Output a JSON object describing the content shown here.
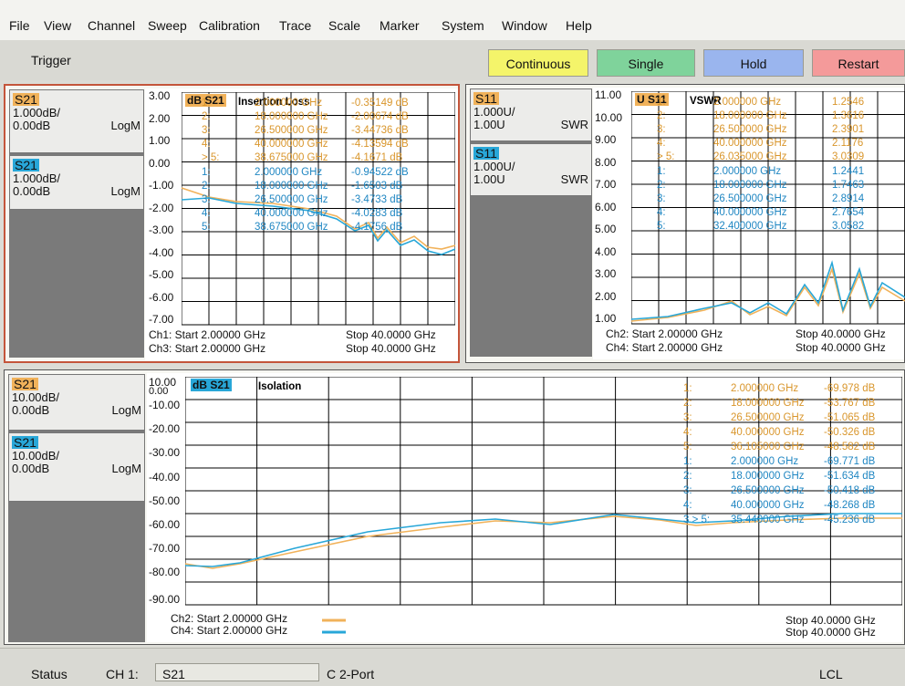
{
  "menu": [
    "File",
    "View",
    "Channel",
    "Sweep",
    "Calibration",
    "Trace",
    "Scale",
    "Marker",
    "System",
    "Window",
    "Help"
  ],
  "trigger": {
    "label": "Trigger",
    "buttons": [
      {
        "label": "Continuous",
        "color": "#f4f46a"
      },
      {
        "label": "Single",
        "color": "#7fd39b"
      },
      {
        "label": "Hold",
        "color": "#9ab5ee"
      },
      {
        "label": "Restart",
        "color": "#f49a9a"
      }
    ]
  },
  "win1": {
    "traces": [
      {
        "name": "S21",
        "scale": "1.000dB/",
        "ref": "0.00dB",
        "fmt": "LogM",
        "color": "#f1b25a"
      },
      {
        "name": "S21",
        "scale": "1.000dB/",
        "ref": "0.00dB",
        "fmt": "LogM",
        "color": "#28a7d8"
      }
    ],
    "title_badge": "dB S21",
    "title": "Insertion Loss",
    "yticks": [
      "3.00",
      "2.00",
      "1.00",
      "0.00",
      "-1.00",
      "-2.00",
      "-3.00",
      "-4.00",
      "-5.00",
      "-6.00",
      "-7.00"
    ],
    "markers_or": [
      {
        "id": "1:",
        "freq": "2.000000 GHz",
        "val": "-0.35149 dB"
      },
      {
        "id": "2:",
        "freq": "18.000000 GHz",
        "val": "-2.00674 dB"
      },
      {
        "id": "3:",
        "freq": "26.500000 GHz",
        "val": "-3.44736 dB"
      },
      {
        "id": "4:",
        "freq": "40.000000 GHz",
        "val": "-4.13594 dB"
      },
      {
        "id": "> 5:",
        "freq": "38.675000 GHz",
        "val": "-4.1671 dB"
      }
    ],
    "markers_bl": [
      {
        "id": "1:",
        "freq": "2.000000 GHz",
        "val": "-0.94522 dB"
      },
      {
        "id": "2:",
        "freq": "18.000000 GHz",
        "val": "-1.6503 dB"
      },
      {
        "id": "3:",
        "freq": "26.500000 GHz",
        "val": "-3.4733 dB"
      },
      {
        "id": "4:",
        "freq": "40.000000 GHz",
        "val": "-4.0283 dB"
      },
      {
        "id": "5:",
        "freq": "38.675000 GHz",
        "val": "-4.1756 dB"
      }
    ],
    "footer1": "Ch1: Start 2.00000 GHz",
    "footer1_stop": "Stop 40.0000 GHz",
    "footer2": "Ch3: Start 2.00000 GHz",
    "footer2_stop": "Stop 40.0000 GHz"
  },
  "win2": {
    "traces": [
      {
        "name": "S11",
        "scale": "1.000U/",
        "ref": "1.00U",
        "fmt": "SWR",
        "color": "#f1b25a"
      },
      {
        "name": "S11",
        "scale": "1.000U/",
        "ref": "1.00U",
        "fmt": "SWR",
        "color": "#28a7d8"
      }
    ],
    "title_badge": "U S11",
    "title": "VSWR",
    "yticks": [
      "11.00",
      "10.00",
      "9.00",
      "8.00",
      "7.00",
      "6.00",
      "5.00",
      "4.00",
      "3.00",
      "2.00",
      "1.00"
    ],
    "markers_or": [
      {
        "id": "1:",
        "freq": "2.000000 GHz",
        "val": "1.2546"
      },
      {
        "id": "2:",
        "freq": "18.000000 GHz",
        "val": "1.3616"
      },
      {
        "id": "3:",
        "freq": "26.500000 GHz",
        "val": "2.3901"
      },
      {
        "id": "4:",
        "freq": "40.000000 GHz",
        "val": "2.1176"
      },
      {
        "id": "> 5:",
        "freq": "26.035000 GHz",
        "val": "3.0309"
      }
    ],
    "markers_bl": [
      {
        "id": "1:",
        "freq": "2.000000 GHz",
        "val": "1.2441"
      },
      {
        "id": "2:",
        "freq": "18.000000 GHz",
        "val": "1.7463"
      },
      {
        "id": "3:",
        "freq": "26.500000 GHz",
        "val": "2.8914"
      },
      {
        "id": "4:",
        "freq": "40.000000 GHz",
        "val": "2.7654"
      },
      {
        "id": "5:",
        "freq": "32.400000 GHz",
        "val": "3.0582"
      }
    ],
    "footer1": "Ch2: Start 2.00000 GHz",
    "footer1_stop": "Stop 40.0000 GHz",
    "footer2": "Ch4: Start 2.00000 GHz",
    "footer2_stop": "Stop 40.0000 GHz"
  },
  "win3": {
    "traces": [
      {
        "name": "S21",
        "scale": "10.00dB/",
        "ref": "0.00dB",
        "fmt": "LogM",
        "color": "#f1b25a"
      },
      {
        "name": "S21",
        "scale": "10.00dB/",
        "ref": "0.00dB",
        "fmt": "LogM",
        "color": "#28a7d8"
      }
    ],
    "title_badge": "dB S21",
    "title": "Isolation",
    "yticks": [
      "10.00",
      "-10.00",
      "-20.00",
      "-30.00",
      "-40.00",
      "-50.00",
      "-60.00",
      "-70.00",
      "-80.00",
      "-90.00"
    ],
    "ytop2": "0.00",
    "markers_or": [
      {
        "id": "1:",
        "freq": "2.000000 GHz",
        "val": "-69.978 dB"
      },
      {
        "id": "2:",
        "freq": "18.000000 GHz",
        "val": "-53.767 dB"
      },
      {
        "id": "3:",
        "freq": "26.500000 GHz",
        "val": "-51.065 dB"
      },
      {
        "id": "4:",
        "freq": "40.000000 GHz",
        "val": "-50.326 dB"
      },
      {
        "id": "5:",
        "freq": "36.105000 GHz",
        "val": "-48.582 dB"
      }
    ],
    "markers_bl": [
      {
        "id": "1:",
        "freq": "2.000000 GHz",
        "val": "-69.771 dB"
      },
      {
        "id": "2:",
        "freq": "18.000000 GHz",
        "val": "-51.634 dB"
      },
      {
        "id": "3:",
        "freq": "26.500000 GHz",
        "val": "-50.418 dB"
      },
      {
        "id": "4:",
        "freq": "40.000000 GHz",
        "val": "-48.268 dB"
      },
      {
        "id": "3 > 5:",
        "freq": "35.440000 GHz",
        "val": "-45.236 dB"
      }
    ],
    "footer1": "Ch2: Start  2.00000 GHz",
    "footer1_stop": "Stop 40.0000 GHz",
    "footer2": "Ch4: Start  2.00000 GHz",
    "footer2_stop": "Stop 40.0000 GHz"
  },
  "status": {
    "label": "Status",
    "ch": "CH 1:",
    "param": "S21",
    "cal": "C 2-Port",
    "lcl": "LCL"
  }
}
